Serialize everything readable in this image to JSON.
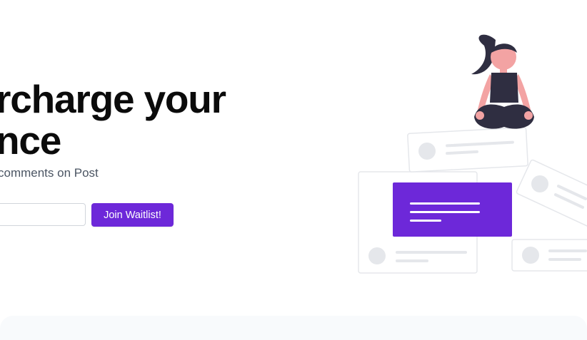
{
  "hero": {
    "headline_line1": "rcharge your",
    "headline_line2": "nce",
    "subtext": "comments on Post",
    "email_input": {
      "value": "",
      "placeholder": ""
    },
    "join_button_label": "Join Waitlist!"
  },
  "illustration": {
    "semantic": "woman-meditating-on-cards",
    "accent_color": "#6d28d9",
    "skin_color": "#f3a3a3",
    "clothing_color": "#2f2e41"
  },
  "colors": {
    "background": "#ffffff",
    "headline": "#0b0b0b",
    "subtext": "#4b5563",
    "accent": "#6d28d9",
    "footer_band": "#f8fafc"
  }
}
